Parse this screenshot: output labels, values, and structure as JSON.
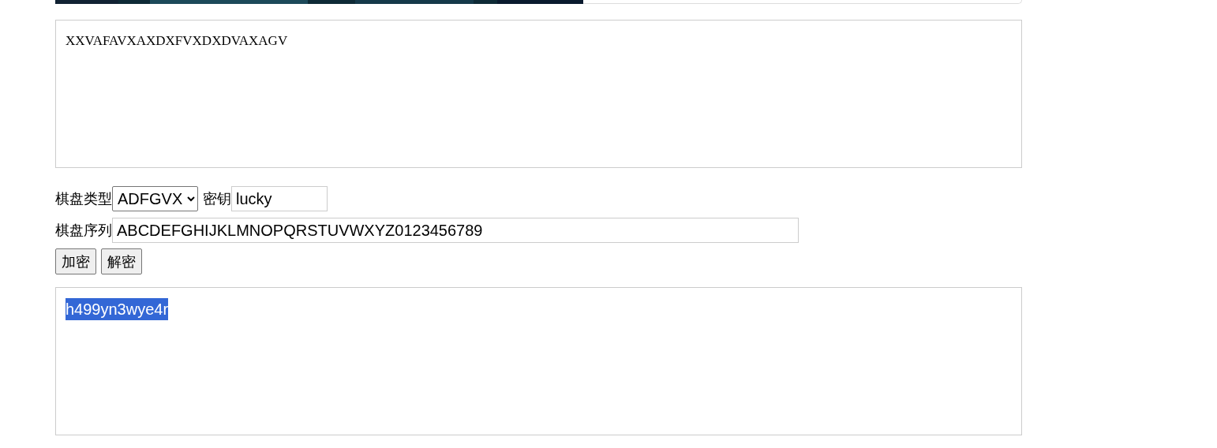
{
  "input_text": {
    "value": "XXVAFAVXAXDXFVXDXDVAXAGV"
  },
  "board_type": {
    "label": "棋盘类型",
    "value": "ADFGVX"
  },
  "key": {
    "label": "密钥",
    "value": "lucky"
  },
  "board_sequence": {
    "label": "棋盘序列",
    "value": "ABCDEFGHIJKLMNOPQRSTUVWXYZ0123456789"
  },
  "buttons": [
    {
      "label": "加密"
    },
    {
      "label": "解密"
    }
  ],
  "output_text": {
    "value": "h499yn3wye4r",
    "selected": true
  }
}
